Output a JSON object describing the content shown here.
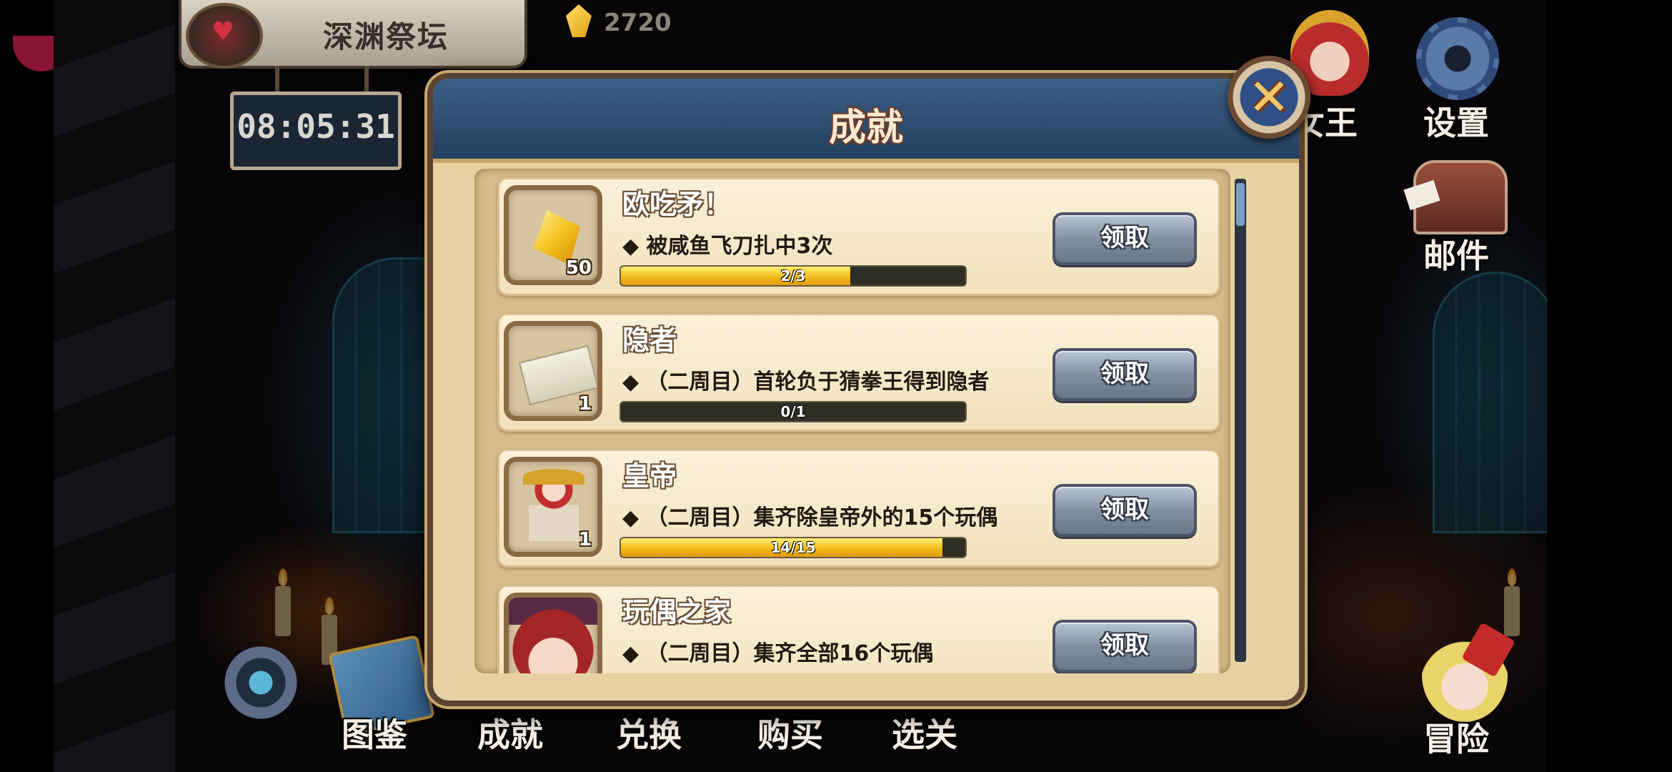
{
  "location": {
    "title": "深渊祭坛"
  },
  "timer": {
    "value": "08:05:31"
  },
  "currency": {
    "icon": "gem-icon",
    "amount": "2720"
  },
  "right_menu": {
    "queen_label": "女王",
    "settings_label": "设置",
    "mail_label": "邮件",
    "adventure_label": "冒险"
  },
  "bottom_menu": {
    "items": [
      "图鉴",
      "成就",
      "兑换",
      "购买",
      "选关"
    ]
  },
  "modal": {
    "title": "成就",
    "claim_label": "领取",
    "achievements": [
      {
        "title": "欧吃矛！",
        "desc": "◆ 被咸鱼飞刀扎中3次",
        "reward_icon": "crystal-icon",
        "reward_count": "50",
        "progress_text": "2/3",
        "progress": 0.667
      },
      {
        "title": "隐者",
        "desc": "◆ （二周目）首轮负于猜拳王得到隐者",
        "reward_icon": "ticket-icon",
        "reward_count": "1",
        "progress_text": "0/1",
        "progress": 0
      },
      {
        "title": "皇帝",
        "desc": "◆ （二周目）集齐除皇帝外的15个玩偶",
        "reward_icon": "emperor-doll-icon",
        "reward_count": "1",
        "progress_text": "14/15",
        "progress": 0.933
      },
      {
        "title": "玩偶之家",
        "desc": "◆ （二周目）集齐全部16个玩偶",
        "reward_icon": "doll-girl-icon",
        "reward_count": "",
        "progress_text": "",
        "progress": 0
      }
    ]
  },
  "colors": {
    "accent": "#f2b718",
    "header": "#23405f",
    "panel": "#e7d1a3"
  }
}
